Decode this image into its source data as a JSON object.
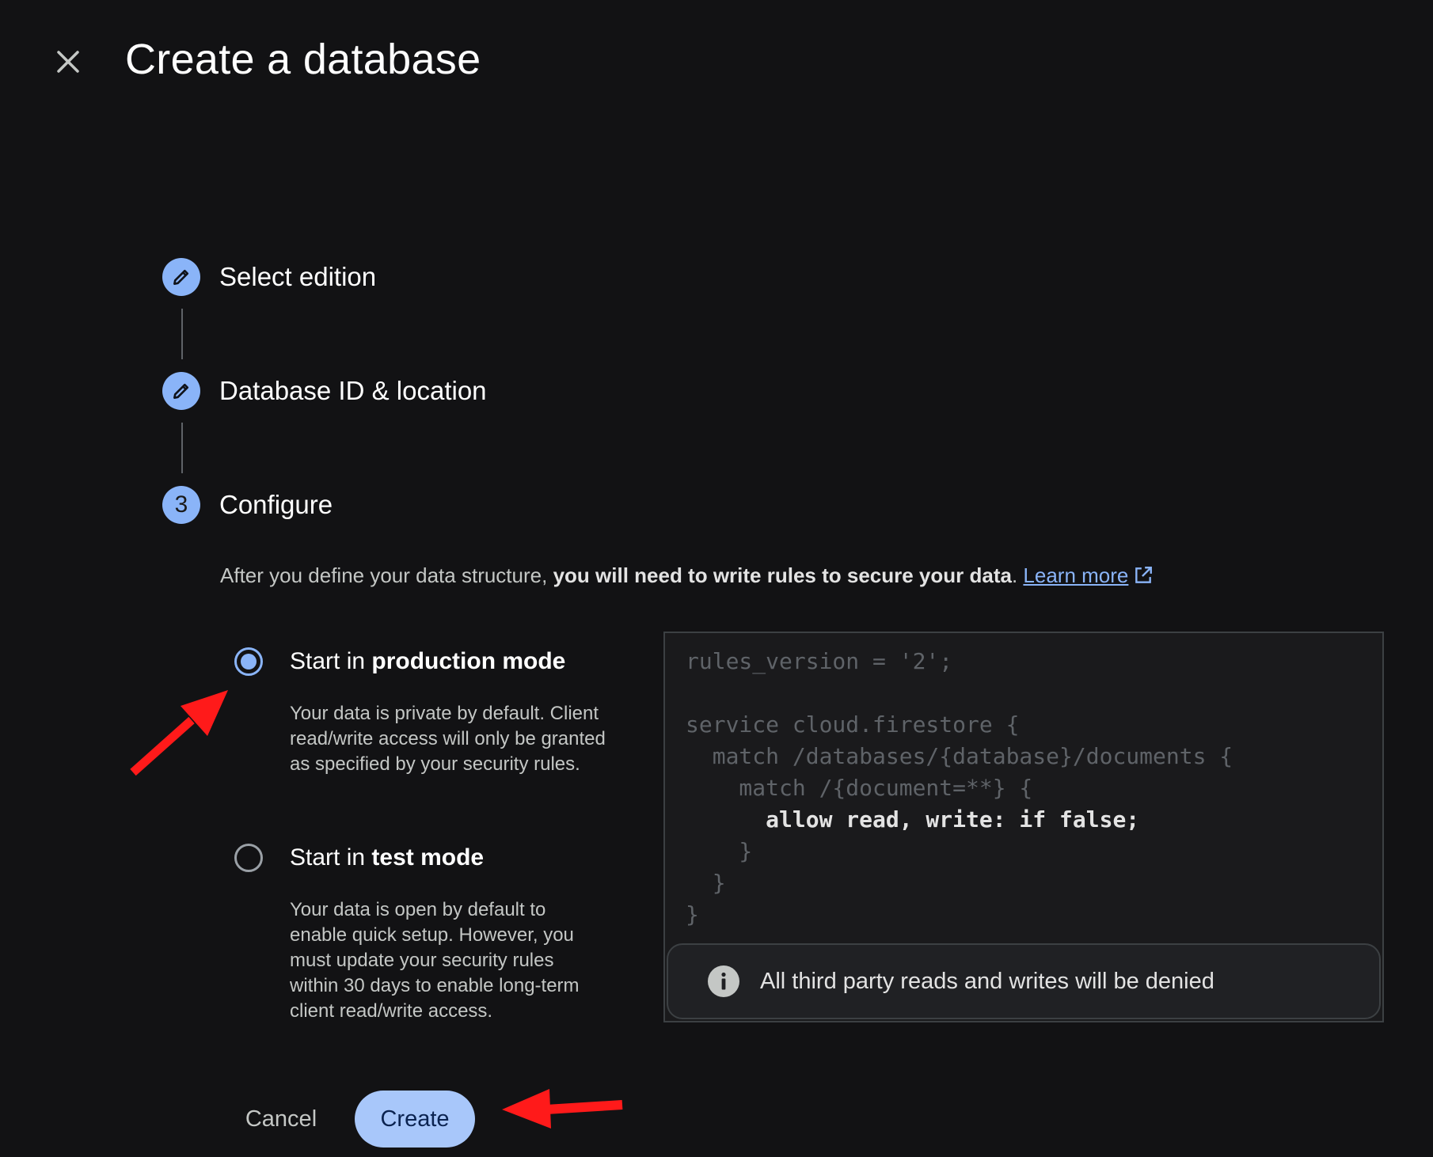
{
  "dialog": {
    "title": "Create a database",
    "close_icon": "close-icon"
  },
  "steps": [
    {
      "label": "Select edition",
      "state": "completed",
      "icon": "pencil-icon"
    },
    {
      "label": "Database ID & location",
      "state": "completed",
      "icon": "pencil-icon"
    },
    {
      "label": "Configure",
      "state": "active",
      "number": "3"
    }
  ],
  "configure": {
    "description_prefix": "After you define your data structure,",
    "description_bold": "you will need to write rules to secure your data",
    "description_suffix": ".",
    "learn_more": "Learn more",
    "learn_more_icon": "external-link-icon"
  },
  "modes": [
    {
      "prefix": "Start in",
      "bold": "production mode",
      "selected": true,
      "description": "Your data is private by default. Client read/write access will only be granted as specified by your security rules."
    },
    {
      "prefix": "Start in",
      "bold": "test mode",
      "selected": false,
      "description": "Your data is open by default to enable quick setup. However, you must update your security rules within 30 days to enable long-term client read/write access."
    }
  ],
  "rules": {
    "lines": [
      "rules_version = '2';",
      "",
      "service cloud.firestore {",
      "  match /databases/{database}/documents {",
      "    match /{document=**} {",
      "      allow read, write: if false;",
      "    }",
      "  }",
      "}"
    ],
    "highlight_line": "      allow read, write: if false;",
    "info_icon": "info-icon",
    "info_text": "All third party reads and writes will be denied"
  },
  "actions": {
    "cancel": "Cancel",
    "create": "Create"
  },
  "colors": {
    "background": "#121214",
    "accent": "#8ab4f8",
    "primary_button": "#a8c7fa",
    "annotation_arrow": "#ff1a1a"
  }
}
